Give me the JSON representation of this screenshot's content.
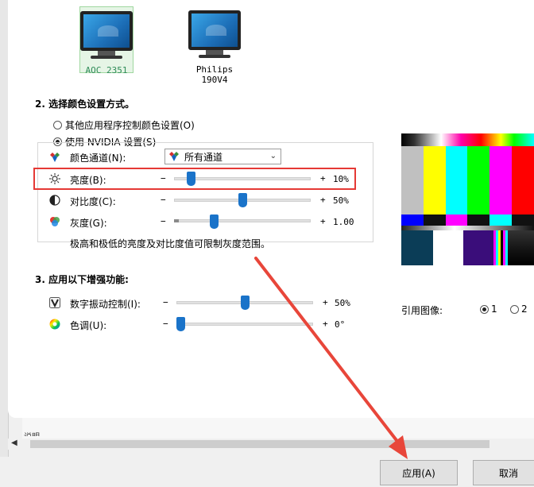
{
  "monitors": [
    {
      "label": "AOC 2351"
    },
    {
      "label": "Philips 190V4"
    }
  ],
  "section2": {
    "title": "2. 选择颜色设置方式。",
    "option_other": "其他应用程序控制颜色设置(O)",
    "option_nvidia": "使用 NVIDIA 设置(S)"
  },
  "color_channel": {
    "label": "颜色通道(N):",
    "selected": "所有通道"
  },
  "brightness": {
    "label": "亮度(B):",
    "minus": "−",
    "plus": "+",
    "value": "10%",
    "level": 0.1
  },
  "contrast": {
    "label": "对比度(C):",
    "minus": "−",
    "plus": "+",
    "value": "50%",
    "level": 0.5
  },
  "gamma": {
    "label": "灰度(G):",
    "minus": "−",
    "plus": "+",
    "value": "1.00",
    "level": 0.3
  },
  "note": "极高和极低的亮度及对比度值可限制灰度范围。",
  "section3": {
    "title": "3. 应用以下增强功能:",
    "vibrance": {
      "label": "数字振动控制(I):",
      "minus": "−",
      "plus": "+",
      "value": "50%",
      "level": 0.5
    },
    "hue": {
      "label": "色调(U):",
      "minus": "−",
      "plus": "+",
      "value": "0°",
      "level": 0.0
    }
  },
  "reference": {
    "label": "引用图像:",
    "opt1": "1",
    "opt2": "2",
    "selected": "1"
  },
  "buttons": {
    "apply": "应用(A)",
    "cancel": "取消"
  },
  "colors": {
    "highlight": "#e53935",
    "slider_thumb": "#1a73c9",
    "arrow": "#e8463a"
  }
}
